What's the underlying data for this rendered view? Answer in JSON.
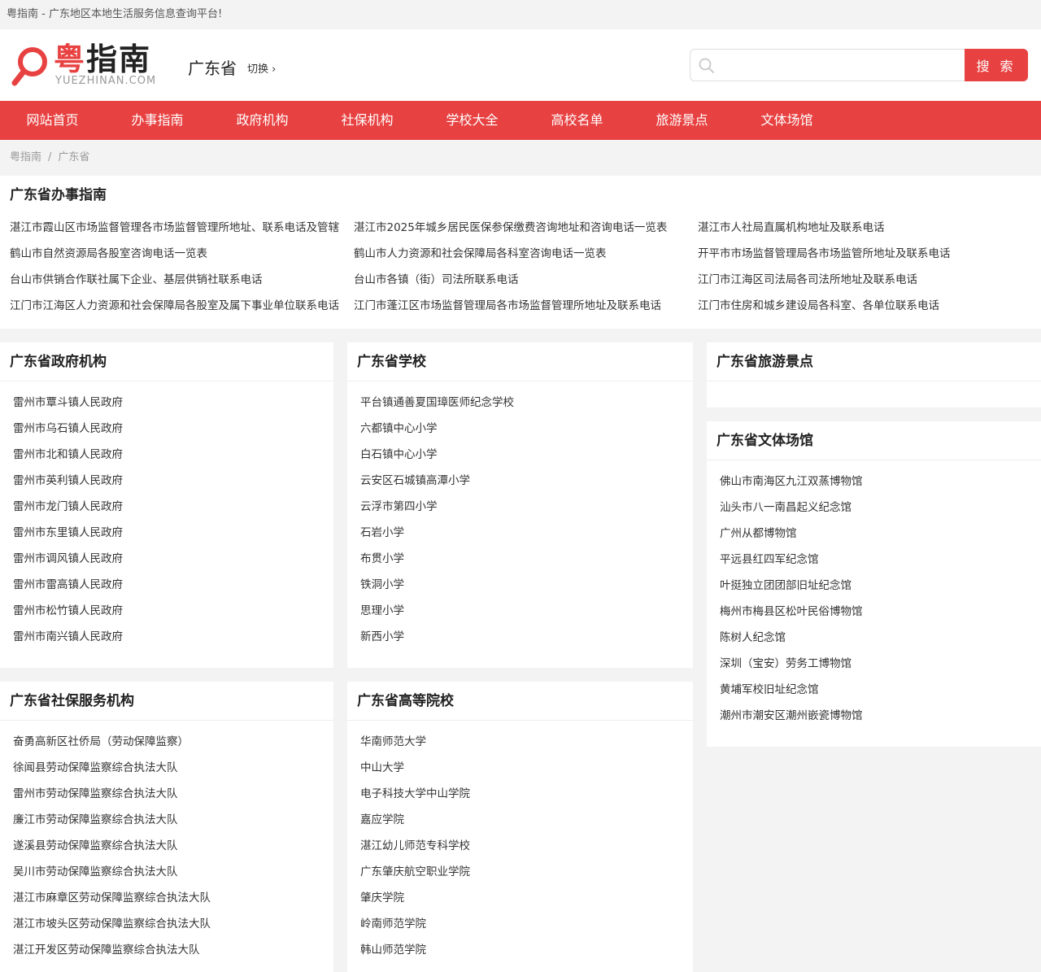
{
  "topbar": {
    "text": "粤指南 - 广东地区本地生活服务信息查询平台!"
  },
  "logo": {
    "main_red": "粤",
    "main_dark": "指南",
    "sub": "YUEZHINAN.COM"
  },
  "header": {
    "province": "广东省",
    "switch_label": "切换 ›"
  },
  "search": {
    "placeholder": "",
    "button_label": "搜 索"
  },
  "colors": {
    "accent": "#e84141"
  },
  "nav": {
    "items": [
      {
        "label": "网站首页"
      },
      {
        "label": "办事指南"
      },
      {
        "label": "政府机构"
      },
      {
        "label": "社保机构"
      },
      {
        "label": "学校大全"
      },
      {
        "label": "高校名单"
      },
      {
        "label": "旅游景点"
      },
      {
        "label": "文体场馆"
      }
    ]
  },
  "breadcrumb": {
    "home": "粤指南",
    "sep": "/",
    "current": "广东省"
  },
  "guide": {
    "title": "广东省办事指南",
    "links": [
      "湛江市霞山区市场监督管理各市场监督管理所地址、联系电话及管辖",
      "湛江市2025年城乡居民医保参保缴费咨询地址和咨询电话一览表",
      "湛江市人社局直属机构地址及联系电话",
      "鹤山市自然资源局各股室咨询电话一览表",
      "鹤山市人力资源和社会保障局各科室咨询电话一览表",
      "开平市市场监督管理局各市场监管所地址及联系电话",
      "台山市供销合作联社属下企业、基层供销社联系电话",
      "台山市各镇（街）司法所联系电话",
      "江门市江海区司法局各司法所地址及联系电话",
      "江门市江海区人力资源和社会保障局各股室及属下事业单位联系电话",
      "江门市蓬江区市场监督管理局各市场监督管理所地址及联系电话",
      "江门市住房和城乡建设局各科室、各单位联系电话"
    ]
  },
  "gov": {
    "title": "广东省政府机构",
    "items": [
      "雷州市覃斗镇人民政府",
      "雷州市乌石镇人民政府",
      "雷州市北和镇人民政府",
      "雷州市英利镇人民政府",
      "雷州市龙门镇人民政府",
      "雷州市东里镇人民政府",
      "雷州市调风镇人民政府",
      "雷州市雷高镇人民政府",
      "雷州市松竹镇人民政府",
      "雷州市南兴镇人民政府"
    ]
  },
  "schools": {
    "title": "广东省学校",
    "items": [
      "平台镇通善夏国璋医师纪念学校",
      "六都镇中心小学",
      "白石镇中心小学",
      "云安区石城镇高潭小学",
      "云浮市第四小学",
      "石岩小学",
      "布贯小学",
      "铁洞小学",
      "思理小学",
      "新西小学"
    ]
  },
  "tourism": {
    "title": "广东省旅游景点",
    "items": []
  },
  "venues": {
    "title": "广东省文体场馆",
    "items": [
      "佛山市南海区九江双蒸博物馆",
      "汕头市八一南昌起义纪念馆",
      "广州从都博物馆",
      "平远县红四军纪念馆",
      "叶挺独立团团部旧址纪念馆",
      "梅州市梅县区松叶民俗博物馆",
      "陈树人纪念馆",
      "深圳（宝安）劳务工博物馆",
      "黄埔军校旧址纪念馆",
      "潮州市潮安区潮州嵌瓷博物馆"
    ]
  },
  "social": {
    "title": "广东省社保服务机构",
    "items": [
      "奋勇高新区社侨局（劳动保障监察）",
      "徐闻县劳动保障监察综合执法大队",
      "雷州市劳动保障监察综合执法大队",
      "廉江市劳动保障监察综合执法大队",
      "遂溪县劳动保障监察综合执法大队",
      "吴川市劳动保障监察综合执法大队",
      "湛江市麻章区劳动保障监察综合执法大队",
      "湛江市坡头区劳动保障监察综合执法大队",
      "湛江开发区劳动保障监察综合执法大队"
    ]
  },
  "colleges": {
    "title": "广东省高等院校",
    "items": [
      "华南师范大学",
      "中山大学",
      "电子科技大学中山学院",
      "嘉应学院",
      "湛江幼儿师范专科学校",
      "广东肇庆航空职业学院",
      "肇庆学院",
      "岭南师范学院",
      "韩山师范学院"
    ]
  }
}
